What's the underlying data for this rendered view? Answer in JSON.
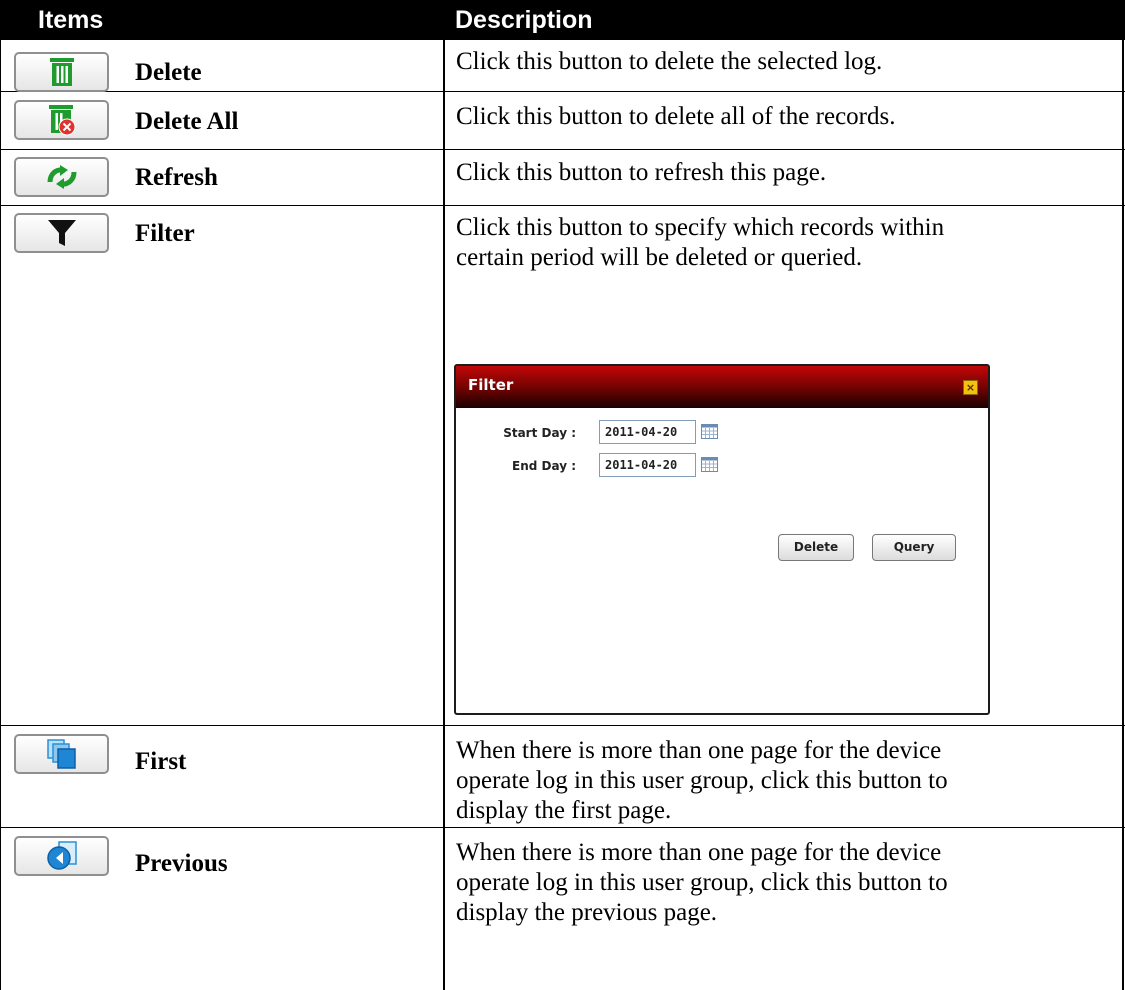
{
  "header": {
    "items": "Items",
    "description": "Description"
  },
  "rows": [
    {
      "label": "Delete",
      "icon": "trash-icon",
      "desc": [
        "Click this button to delete the selected log."
      ]
    },
    {
      "label": "Delete All",
      "icon": "trash-delete-all-icon",
      "desc": [
        "Click this button to delete all of the records."
      ]
    },
    {
      "label": "Refresh",
      "icon": "refresh-icon",
      "desc": [
        "Click this button to refresh this page."
      ]
    },
    {
      "label": "Filter",
      "icon": "filter-funnel-icon",
      "desc": [
        "Click this button to specify which records within",
        "certain period will be deleted or queried."
      ]
    },
    {
      "label": "First",
      "icon": "first-page-icon",
      "desc": [
        "When there is more than one page for the device",
        "operate log in this user group, click this button to",
        "display the first page."
      ]
    },
    {
      "label": "Previous",
      "icon": "previous-page-icon",
      "desc": [
        "When there is more than one page for the device",
        "operate log in this user group, click this button to",
        "display the previous page."
      ]
    }
  ],
  "dialog": {
    "title": "Filter",
    "start_label": "Start Day :",
    "start_value": "2011-04-20",
    "end_label": "End Day :",
    "end_value": "2011-04-20",
    "delete_label": "Delete",
    "query_label": "Query"
  },
  "colors": {
    "header_bg": "#000000",
    "dialog_title": "#a30505",
    "icon_green": "#1e9c2e",
    "icon_blue": "#2b8fd8"
  }
}
